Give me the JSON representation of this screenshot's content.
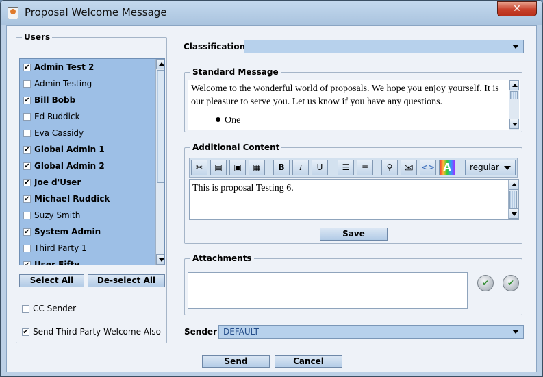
{
  "window": {
    "title": "Proposal Welcome Message",
    "close_glyph": "✕"
  },
  "users": {
    "legend": "Users",
    "items": [
      {
        "label": "Admin Test 2",
        "checked": true
      },
      {
        "label": "Admin Testing",
        "checked": false
      },
      {
        "label": "Bill Bobb",
        "checked": true
      },
      {
        "label": "Ed Ruddick",
        "checked": false
      },
      {
        "label": "Eva Cassidy",
        "checked": false
      },
      {
        "label": "Global Admin 1",
        "checked": true
      },
      {
        "label": "Global Admin 2",
        "checked": true
      },
      {
        "label": "Joe d'User",
        "checked": true
      },
      {
        "label": "Michael Ruddick",
        "checked": true
      },
      {
        "label": "Suzy Smith",
        "checked": false
      },
      {
        "label": "System Admin",
        "checked": true
      },
      {
        "label": "Third Party 1",
        "checked": false
      },
      {
        "label": "User Fifty",
        "checked": true
      }
    ],
    "select_all": "Select All",
    "deselect_all": "De-select All",
    "cc_sender": "CC Sender",
    "send_third_party": "Send Third Party Welcome Also"
  },
  "classification": {
    "label": "Classification",
    "value": ""
  },
  "standard_message": {
    "legend": "Standard Message",
    "text": "Welcome to the wonderful world of proposals. We hope you enjoy yourself. It is our pleasure to serve you. Let us know if you have any questions.",
    "bullet": "One"
  },
  "additional_content": {
    "legend": "Additional Content",
    "text": "This is proposal Testing 6.",
    "style_value": "regular",
    "save": "Save",
    "tools": {
      "bold": "B",
      "italic": "I",
      "underline": "U",
      "color": "A"
    }
  },
  "attachments": {
    "legend": "Attachments"
  },
  "sender": {
    "label": "Sender",
    "value": "DEFAULT"
  },
  "footer": {
    "send": "Send",
    "cancel": "Cancel"
  },
  "icons": [
    "java-icon",
    "cut-icon",
    "copy-icon",
    "paste-icon",
    "paste-special-icon",
    "bulleted-list-icon",
    "numbered-list-icon",
    "link-icon",
    "email-icon",
    "code-icon",
    "color-icon",
    "add-attachment-icon",
    "remove-attachment-icon"
  ]
}
